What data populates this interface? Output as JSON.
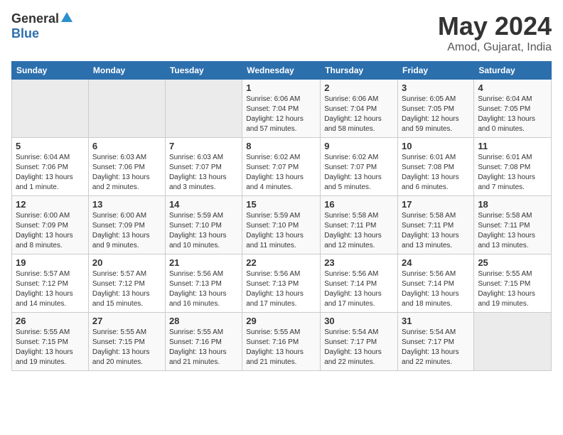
{
  "header": {
    "logo_general": "General",
    "logo_blue": "Blue",
    "month": "May 2024",
    "location": "Amod, Gujarat, India"
  },
  "days_of_week": [
    "Sunday",
    "Monday",
    "Tuesday",
    "Wednesday",
    "Thursday",
    "Friday",
    "Saturday"
  ],
  "weeks": [
    [
      {
        "day": "",
        "info": ""
      },
      {
        "day": "",
        "info": ""
      },
      {
        "day": "",
        "info": ""
      },
      {
        "day": "1",
        "info": "Sunrise: 6:06 AM\nSunset: 7:04 PM\nDaylight: 12 hours and 57 minutes."
      },
      {
        "day": "2",
        "info": "Sunrise: 6:06 AM\nSunset: 7:04 PM\nDaylight: 12 hours and 58 minutes."
      },
      {
        "day": "3",
        "info": "Sunrise: 6:05 AM\nSunset: 7:05 PM\nDaylight: 12 hours and 59 minutes."
      },
      {
        "day": "4",
        "info": "Sunrise: 6:04 AM\nSunset: 7:05 PM\nDaylight: 13 hours and 0 minutes."
      }
    ],
    [
      {
        "day": "5",
        "info": "Sunrise: 6:04 AM\nSunset: 7:06 PM\nDaylight: 13 hours and 1 minute."
      },
      {
        "day": "6",
        "info": "Sunrise: 6:03 AM\nSunset: 7:06 PM\nDaylight: 13 hours and 2 minutes."
      },
      {
        "day": "7",
        "info": "Sunrise: 6:03 AM\nSunset: 7:07 PM\nDaylight: 13 hours and 3 minutes."
      },
      {
        "day": "8",
        "info": "Sunrise: 6:02 AM\nSunset: 7:07 PM\nDaylight: 13 hours and 4 minutes."
      },
      {
        "day": "9",
        "info": "Sunrise: 6:02 AM\nSunset: 7:07 PM\nDaylight: 13 hours and 5 minutes."
      },
      {
        "day": "10",
        "info": "Sunrise: 6:01 AM\nSunset: 7:08 PM\nDaylight: 13 hours and 6 minutes."
      },
      {
        "day": "11",
        "info": "Sunrise: 6:01 AM\nSunset: 7:08 PM\nDaylight: 13 hours and 7 minutes."
      }
    ],
    [
      {
        "day": "12",
        "info": "Sunrise: 6:00 AM\nSunset: 7:09 PM\nDaylight: 13 hours and 8 minutes."
      },
      {
        "day": "13",
        "info": "Sunrise: 6:00 AM\nSunset: 7:09 PM\nDaylight: 13 hours and 9 minutes."
      },
      {
        "day": "14",
        "info": "Sunrise: 5:59 AM\nSunset: 7:10 PM\nDaylight: 13 hours and 10 minutes."
      },
      {
        "day": "15",
        "info": "Sunrise: 5:59 AM\nSunset: 7:10 PM\nDaylight: 13 hours and 11 minutes."
      },
      {
        "day": "16",
        "info": "Sunrise: 5:58 AM\nSunset: 7:11 PM\nDaylight: 13 hours and 12 minutes."
      },
      {
        "day": "17",
        "info": "Sunrise: 5:58 AM\nSunset: 7:11 PM\nDaylight: 13 hours and 13 minutes."
      },
      {
        "day": "18",
        "info": "Sunrise: 5:58 AM\nSunset: 7:11 PM\nDaylight: 13 hours and 13 minutes."
      }
    ],
    [
      {
        "day": "19",
        "info": "Sunrise: 5:57 AM\nSunset: 7:12 PM\nDaylight: 13 hours and 14 minutes."
      },
      {
        "day": "20",
        "info": "Sunrise: 5:57 AM\nSunset: 7:12 PM\nDaylight: 13 hours and 15 minutes."
      },
      {
        "day": "21",
        "info": "Sunrise: 5:56 AM\nSunset: 7:13 PM\nDaylight: 13 hours and 16 minutes."
      },
      {
        "day": "22",
        "info": "Sunrise: 5:56 AM\nSunset: 7:13 PM\nDaylight: 13 hours and 17 minutes."
      },
      {
        "day": "23",
        "info": "Sunrise: 5:56 AM\nSunset: 7:14 PM\nDaylight: 13 hours and 17 minutes."
      },
      {
        "day": "24",
        "info": "Sunrise: 5:56 AM\nSunset: 7:14 PM\nDaylight: 13 hours and 18 minutes."
      },
      {
        "day": "25",
        "info": "Sunrise: 5:55 AM\nSunset: 7:15 PM\nDaylight: 13 hours and 19 minutes."
      }
    ],
    [
      {
        "day": "26",
        "info": "Sunrise: 5:55 AM\nSunset: 7:15 PM\nDaylight: 13 hours and 19 minutes."
      },
      {
        "day": "27",
        "info": "Sunrise: 5:55 AM\nSunset: 7:15 PM\nDaylight: 13 hours and 20 minutes."
      },
      {
        "day": "28",
        "info": "Sunrise: 5:55 AM\nSunset: 7:16 PM\nDaylight: 13 hours and 21 minutes."
      },
      {
        "day": "29",
        "info": "Sunrise: 5:55 AM\nSunset: 7:16 PM\nDaylight: 13 hours and 21 minutes."
      },
      {
        "day": "30",
        "info": "Sunrise: 5:54 AM\nSunset: 7:17 PM\nDaylight: 13 hours and 22 minutes."
      },
      {
        "day": "31",
        "info": "Sunrise: 5:54 AM\nSunset: 7:17 PM\nDaylight: 13 hours and 22 minutes."
      },
      {
        "day": "",
        "info": ""
      }
    ]
  ]
}
